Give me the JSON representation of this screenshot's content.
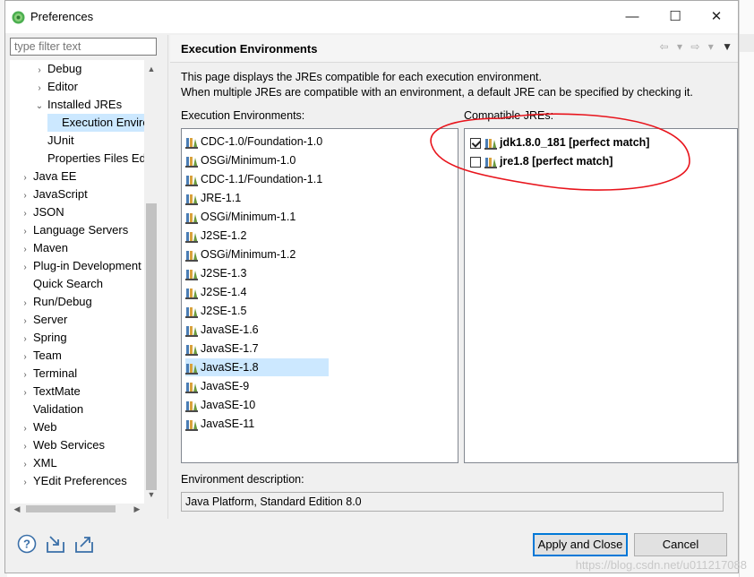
{
  "window": {
    "title": "Preferences",
    "app_icon": "eclipse-icon"
  },
  "titlebar_buttons": {
    "minimize": "—",
    "maximize": "☐",
    "close": "✕"
  },
  "filter": {
    "placeholder": "type filter text"
  },
  "tree": {
    "items": [
      {
        "label": "Debug",
        "chev": "›",
        "level": 2
      },
      {
        "label": "Editor",
        "chev": "›",
        "level": 2
      },
      {
        "label": "Installed JREs",
        "chev": "⌄",
        "level": 2
      },
      {
        "label": "Execution Enviro",
        "chev": "",
        "level": 3,
        "selected": true
      },
      {
        "label": "JUnit",
        "chev": "",
        "level": 2
      },
      {
        "label": "Properties Files Edi",
        "chev": "",
        "level": 2
      },
      {
        "label": "Java EE",
        "chev": "›",
        "level": 1
      },
      {
        "label": "JavaScript",
        "chev": "›",
        "level": 1
      },
      {
        "label": "JSON",
        "chev": "›",
        "level": 1
      },
      {
        "label": "Language Servers",
        "chev": "›",
        "level": 1
      },
      {
        "label": "Maven",
        "chev": "›",
        "level": 1
      },
      {
        "label": "Plug-in Development",
        "chev": "›",
        "level": 1
      },
      {
        "label": "Quick Search",
        "chev": "",
        "level": 1
      },
      {
        "label": "Run/Debug",
        "chev": "›",
        "level": 1
      },
      {
        "label": "Server",
        "chev": "›",
        "level": 1
      },
      {
        "label": "Spring",
        "chev": "›",
        "level": 1
      },
      {
        "label": "Team",
        "chev": "›",
        "level": 1
      },
      {
        "label": "Terminal",
        "chev": "›",
        "level": 1
      },
      {
        "label": "TextMate",
        "chev": "›",
        "level": 1
      },
      {
        "label": "Validation",
        "chev": "",
        "level": 1
      },
      {
        "label": "Web",
        "chev": "›",
        "level": 1
      },
      {
        "label": "Web Services",
        "chev": "›",
        "level": 1
      },
      {
        "label": "XML",
        "chev": "›",
        "level": 1
      },
      {
        "label": "YEdit Preferences",
        "chev": "›",
        "level": 1
      }
    ]
  },
  "scrollbar": {
    "up": "▲",
    "down": "▼",
    "left": "◀",
    "right": "▶"
  },
  "page": {
    "title": "Execution Environments",
    "nav": {
      "back": "⇦",
      "back_menu": "▾",
      "forward": "⇨",
      "forward_menu": "▾",
      "view_menu": "▼"
    },
    "description_line1": "This page displays the JREs compatible for each execution environment.",
    "description_line2": "When multiple JREs are compatible with an environment, a default JRE can be specified by checking it.",
    "environments_label": "Execution Environments:",
    "jres_label": "Compatible JREs:",
    "environments": [
      "CDC-1.0/Foundation-1.0",
      "OSGi/Minimum-1.0",
      "CDC-1.1/Foundation-1.1",
      "JRE-1.1",
      "OSGi/Minimum-1.1",
      "J2SE-1.2",
      "OSGi/Minimum-1.2",
      "J2SE-1.3",
      "J2SE-1.4",
      "J2SE-1.5",
      "JavaSE-1.6",
      "JavaSE-1.7",
      "JavaSE-1.8",
      "JavaSE-9",
      "JavaSE-10",
      "JavaSE-11"
    ],
    "selected_environment": "JavaSE-1.8",
    "jres": [
      {
        "label": "jdk1.8.0_181 [perfect match]",
        "checked": true
      },
      {
        "label": "jre1.8 [perfect match]",
        "checked": false
      }
    ],
    "env_description_label": "Environment description:",
    "env_description_value": "Java Platform, Standard Edition 8.0"
  },
  "bottom": {
    "icons": [
      "help-icon",
      "import-icon",
      "export-icon"
    ],
    "help_glyph": "?",
    "apply_close_label": "Apply and Close",
    "cancel_label": "Cancel"
  },
  "watermark": "https://blog.csdn.net/u011217088",
  "colors": {
    "selection": "#cce8ff",
    "accent": "#0078d7",
    "annotation": "#e8141c"
  }
}
